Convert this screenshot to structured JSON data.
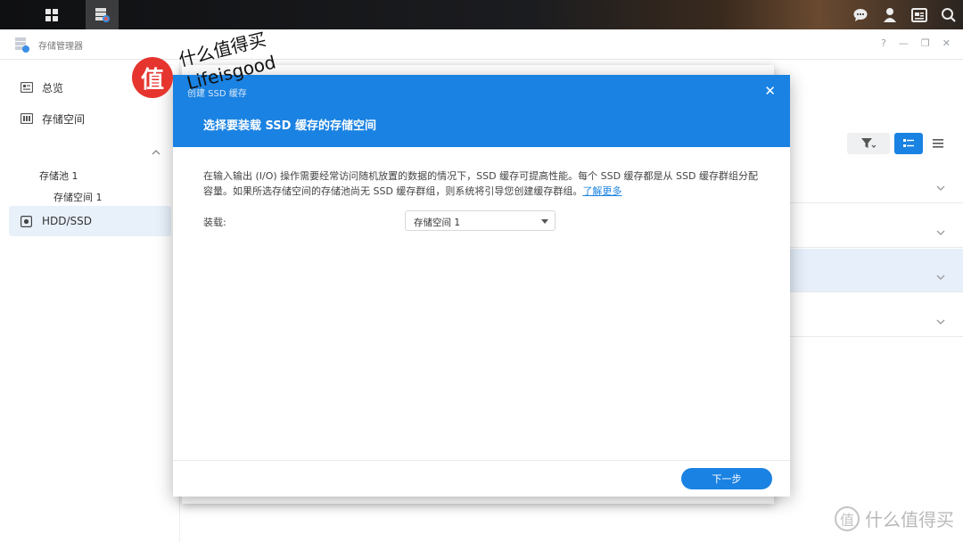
{
  "app": {
    "title": "存储管理器",
    "window_controls": [
      "?",
      "—",
      "❐",
      "✕"
    ]
  },
  "sidebar": {
    "items": [
      {
        "label": "总览"
      },
      {
        "label": "存储空间"
      },
      {
        "label": "存储池 1"
      },
      {
        "label": "存储空间 1"
      },
      {
        "label": "HDD/SSD"
      }
    ]
  },
  "dialog": {
    "small_title": "创建 SSD 缓存",
    "close": "✕",
    "title": "选择要装载 SSD 缓存的存储空间",
    "description": "在输入输出 (I/O) 操作需要经常访问随机放置的数据的情况下，SSD 缓存可提高性能。每个 SSD 缓存都是从 SSD 缓存群组分配容量。如果所选存储空间的存储池尚无 SSD 缓存群组，则系统将引导您创建缓存群组。",
    "learn_more": "了解更多",
    "mount_label": "装载:",
    "mount_value": "存储空间 1",
    "next_button": "下一步"
  },
  "watermark": {
    "badge": "值",
    "cn": "什么值得买",
    "en": "Lifeisgood",
    "corner_badge": "值",
    "corner_text": "什么值得买"
  },
  "colors": {
    "accent": "#1a82e2",
    "selected_bg": "#e8f0fa",
    "watermark_red": "#e5352e"
  }
}
